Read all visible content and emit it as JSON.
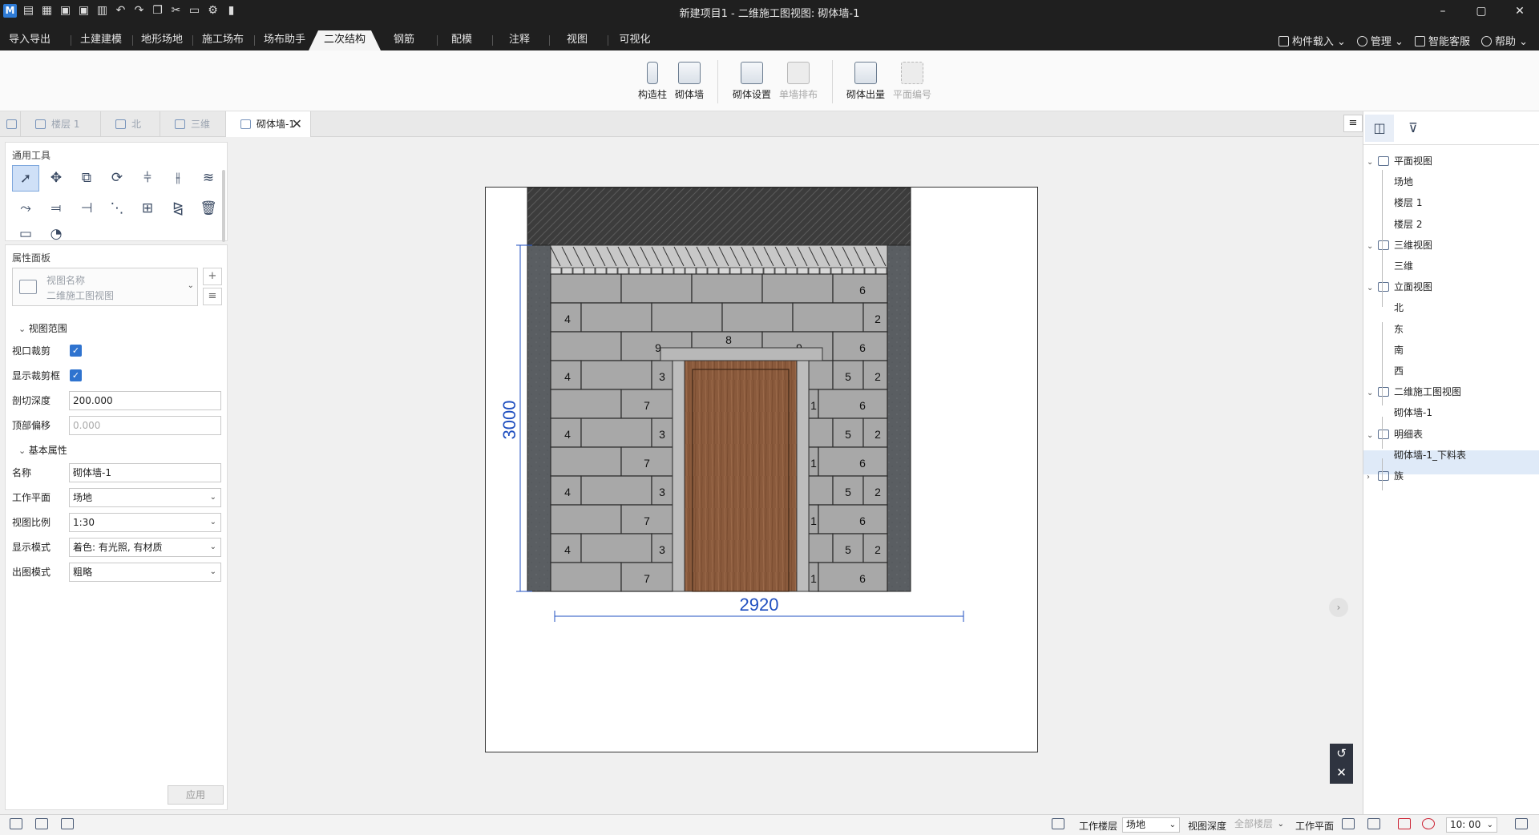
{
  "app": {
    "title": "新建项目1 - 二维施工图视图: 砌体墙-1",
    "logo": "M",
    "win_min": "–",
    "win_max": "▢",
    "win_close": "✕"
  },
  "menu": {
    "tabs": [
      "导入导出",
      "土建建模",
      "地形场地",
      "施工场布",
      "场布助手",
      "二次结构",
      "钢筋",
      "配模",
      "注释",
      "视图",
      "可视化"
    ],
    "active": 5,
    "right": [
      "构件载入",
      "管理",
      "智能客服",
      "帮助"
    ]
  },
  "ribbon": {
    "buttons": [
      {
        "label": "构造柱",
        "disabled": false
      },
      {
        "label": "砌体墙",
        "disabled": false
      },
      {
        "label": "砌体设置",
        "disabled": false
      },
      {
        "label": "单墙排布",
        "disabled": true
      },
      {
        "label": "砌体出量",
        "disabled": false
      },
      {
        "label": "平面编号",
        "disabled": true
      }
    ]
  },
  "doctabs": {
    "tabs": [
      "楼层 1",
      "北",
      "三维",
      "砌体墙-1"
    ],
    "active": 3,
    "close": "✕",
    "menu": "≡"
  },
  "tools": {
    "title": "通用工具"
  },
  "props": {
    "title": "属性面板",
    "view_name_label": "视图名称",
    "view_name_value": "二维施工图视图",
    "sec_range": "视图范围",
    "sec_basic": "基本属性",
    "rows": {
      "crop": "视口裁剪",
      "crop_box": "显示裁剪框",
      "cut_depth": "剖切深度",
      "top_offset": "顶部偏移",
      "name": "名称",
      "work_plane": "工作平面",
      "scale": "视图比例",
      "display_mode": "显示模式",
      "output_mode": "出图模式"
    },
    "values": {
      "cut_depth": "200.000",
      "top_offset": "0.000",
      "name": "砌体墙-1",
      "work_plane": "场地",
      "scale": "1:30",
      "display_mode": "着色: 有光照, 有材质",
      "output_mode": "粗略"
    },
    "apply": "应用"
  },
  "drawing": {
    "width_dim": "2920",
    "height_dim": "3000",
    "rows": [
      [
        {
          "t": ""
        },
        {
          "t": ""
        },
        {
          "t": ""
        },
        {
          "t": ""
        },
        {
          "t": "6"
        }
      ],
      [
        {
          "t": "4"
        },
        {
          "t": ""
        },
        {
          "t": ""
        },
        {
          "t": ""
        },
        {
          "t": ""
        },
        {
          "t": "2"
        }
      ]
    ],
    "labels": {
      "r3": [
        "9",
        "8",
        "9",
        "6"
      ],
      "left_a": [
        "4",
        "3"
      ],
      "left_b": [
        "7"
      ],
      "right_a": [
        "5",
        "2"
      ],
      "right_b": [
        "1",
        "6"
      ]
    }
  },
  "tree": {
    "nodes": [
      {
        "label": "平面视图",
        "level": 0,
        "exp": "⌄"
      },
      {
        "label": "场地",
        "level": 1
      },
      {
        "label": "楼层 1",
        "level": 1
      },
      {
        "label": "楼层 2",
        "level": 1
      },
      {
        "label": "三维视图",
        "level": 0,
        "exp": "⌄"
      },
      {
        "label": "三维",
        "level": 1
      },
      {
        "label": "立面视图",
        "level": 0,
        "exp": "⌄"
      },
      {
        "label": "北",
        "level": 1
      },
      {
        "label": "东",
        "level": 1
      },
      {
        "label": "南",
        "level": 1
      },
      {
        "label": "西",
        "level": 1
      },
      {
        "label": "二维施工图视图",
        "level": 0,
        "exp": "⌄"
      },
      {
        "label": "砌体墙-1",
        "level": 1,
        "selected": true
      },
      {
        "label": "明细表",
        "level": 0,
        "exp": "⌄"
      },
      {
        "label": "砌体墙-1_下料表",
        "level": 1
      },
      {
        "label": "族",
        "level": 0,
        "exp": "›"
      }
    ]
  },
  "status": {
    "layer_label": "工作楼层",
    "layer_value": "场地",
    "depth_label": "视图深度",
    "depth_value": "全部楼层",
    "plane_label": "工作平面",
    "time_value": "10: 00"
  }
}
